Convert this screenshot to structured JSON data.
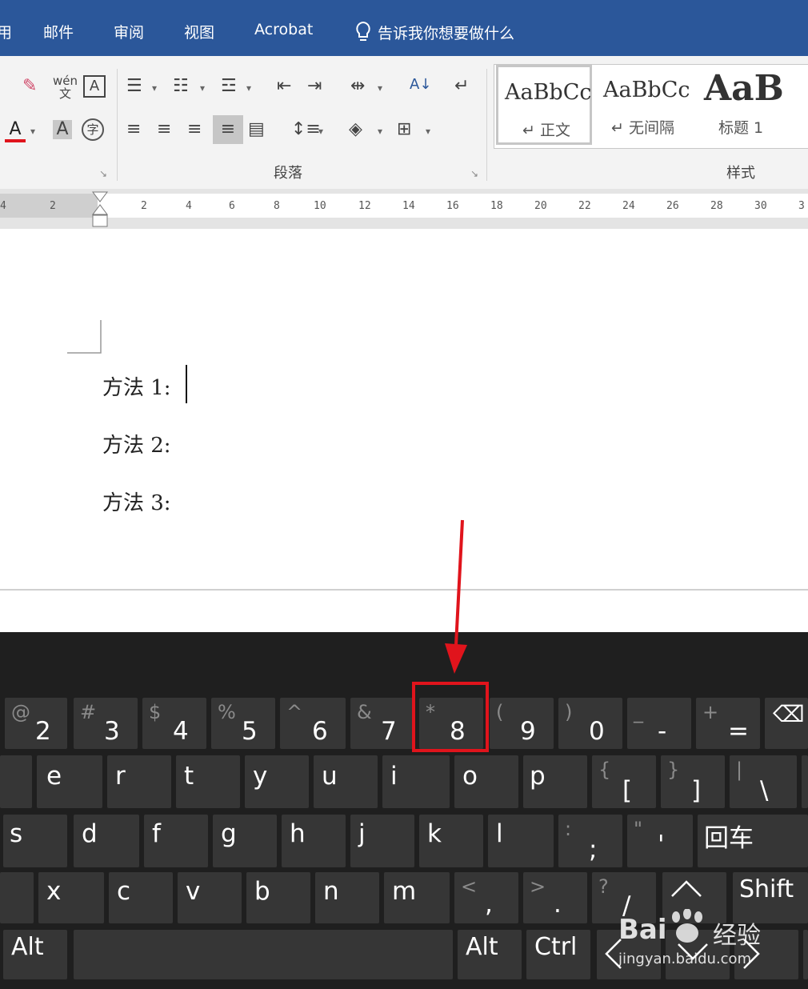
{
  "menubar": {
    "items": [
      "用",
      "邮件",
      "审阅",
      "视图",
      "Acrobat"
    ],
    "tell_me": "告诉我你想要做什么"
  },
  "ribbon": {
    "paragraph_group_label": "段落",
    "styles_group_label": "样式",
    "styles": [
      {
        "sample": "AaBbCc",
        "name": "↵ 正文"
      },
      {
        "sample": "AaBbCc",
        "name": "↵ 无间隔"
      },
      {
        "sample": "AaB",
        "name": "标题 1"
      }
    ]
  },
  "ruler": {
    "ticks": [
      "4",
      "2",
      "2",
      "4",
      "6",
      "8",
      "10",
      "12",
      "14",
      "16",
      "18",
      "20",
      "22",
      "24",
      "26",
      "28",
      "30",
      "3"
    ]
  },
  "document": {
    "lines": [
      "方法 1:",
      "方法 2:",
      "方法 3:"
    ]
  },
  "keyboard": {
    "row1": [
      {
        "shift": "@",
        "main": "2"
      },
      {
        "shift": "#",
        "main": "3"
      },
      {
        "shift": "$",
        "main": "4"
      },
      {
        "shift": "%",
        "main": "5"
      },
      {
        "shift": "^",
        "main": "6"
      },
      {
        "shift": "&",
        "main": "7"
      },
      {
        "shift": "*",
        "main": "8"
      },
      {
        "shift": "(",
        "main": "9"
      },
      {
        "shift": ")",
        "main": "0"
      },
      {
        "shift": "_",
        "main": "-"
      },
      {
        "shift": "+",
        "main": "="
      },
      {
        "shift": "",
        "main": "⌫"
      }
    ],
    "row2": [
      {
        "shift": "",
        "main": ""
      },
      {
        "shift": "",
        "main": "e"
      },
      {
        "shift": "",
        "main": "r"
      },
      {
        "shift": "",
        "main": "t"
      },
      {
        "shift": "",
        "main": "y"
      },
      {
        "shift": "",
        "main": "u"
      },
      {
        "shift": "",
        "main": "i"
      },
      {
        "shift": "",
        "main": "o"
      },
      {
        "shift": "",
        "main": "p"
      },
      {
        "shift": "{",
        "main": "["
      },
      {
        "shift": "}",
        "main": "]"
      },
      {
        "shift": "|",
        "main": "\\"
      }
    ],
    "row3": [
      {
        "shift": "",
        "main": "s"
      },
      {
        "shift": "",
        "main": "d"
      },
      {
        "shift": "",
        "main": "f"
      },
      {
        "shift": "",
        "main": "g"
      },
      {
        "shift": "",
        "main": "h"
      },
      {
        "shift": "",
        "main": "j"
      },
      {
        "shift": "",
        "main": "k"
      },
      {
        "shift": "",
        "main": "l"
      },
      {
        "shift": ":",
        "main": ";"
      },
      {
        "shift": "\"",
        "main": "'"
      },
      {
        "shift": "",
        "main": "回车"
      }
    ],
    "row4": [
      {
        "shift": "",
        "main": ""
      },
      {
        "shift": "",
        "main": "x"
      },
      {
        "shift": "",
        "main": "c"
      },
      {
        "shift": "",
        "main": "v"
      },
      {
        "shift": "",
        "main": "b"
      },
      {
        "shift": "",
        "main": "n"
      },
      {
        "shift": "",
        "main": "m"
      },
      {
        "shift": "<",
        "main": ","
      },
      {
        "shift": ">",
        "main": "."
      },
      {
        "shift": "?",
        "main": "/"
      },
      {
        "shift": "",
        "main": "^"
      },
      {
        "shift": "",
        "main": "Shift"
      }
    ],
    "row5": [
      {
        "shift": "",
        "main": "Alt"
      },
      {
        "shift": "",
        "main": ""
      },
      {
        "shift": "",
        "main": "Alt"
      },
      {
        "shift": "",
        "main": "Ctrl"
      },
      {
        "shift": "",
        "main": "<"
      },
      {
        "shift": "",
        "main": "v"
      },
      {
        "shift": "",
        "main": ">"
      }
    ],
    "highlighted_key": "8"
  },
  "watermark": {
    "brand": "Bai",
    "brand2": "经验",
    "url": "jingyan.baidu.com"
  },
  "colors": {
    "menubar": "#2b579a",
    "highlight": "#e0141c",
    "keyboard_bg": "#1f1f1f",
    "key_bg": "#363636"
  }
}
